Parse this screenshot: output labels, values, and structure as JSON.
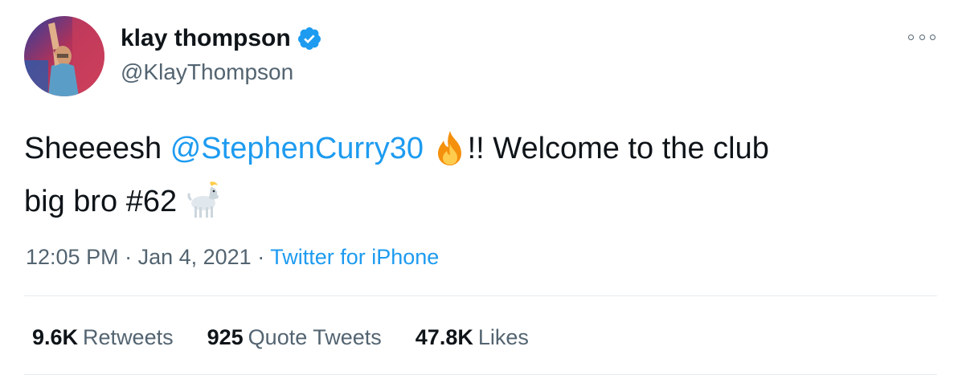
{
  "author": {
    "display_name": "klay thompson",
    "handle": "@KlayThompson",
    "verified": true
  },
  "tweet": {
    "text_part1": "Sheeeesh ",
    "mention": "@StephenCurry30",
    "text_part2": "!! Welcome to the club",
    "text_line2": "big bro #62",
    "emoji_1": "fire-emoji",
    "emoji_2": "goat-emoji"
  },
  "meta": {
    "time": "12:05 PM",
    "separator": " · ",
    "date": "Jan 4, 2021",
    "source": "Twitter for iPhone"
  },
  "stats": {
    "retweets_count": "9.6K",
    "retweets_label": "Retweets",
    "quotes_count": "925",
    "quotes_label": "Quote Tweets",
    "likes_count": "47.8K",
    "likes_label": "Likes"
  },
  "colors": {
    "link": "#1d9bf0",
    "secondary_text": "#536471",
    "primary_text": "#0f1419",
    "verified_badge": "#1d9bf0",
    "divider": "#e6ecf0"
  }
}
